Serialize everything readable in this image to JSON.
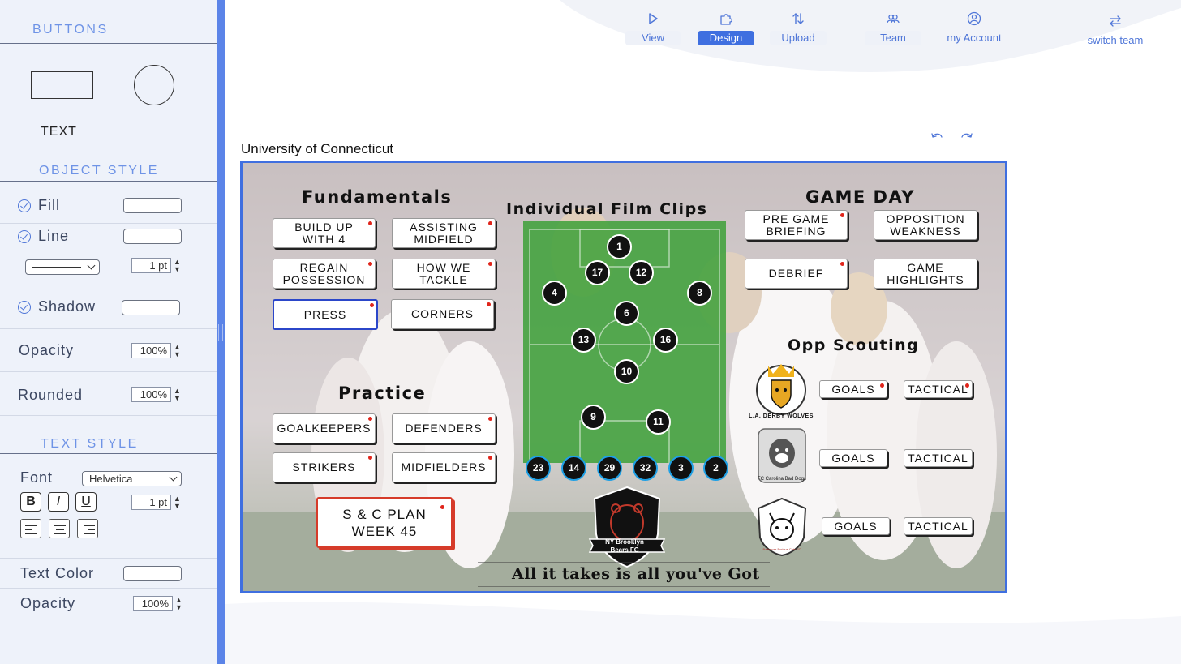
{
  "sidebar": {
    "buttons_title": "BUTTONS",
    "text_tool": "TEXT",
    "object_style_title": "OBJECT STYLE",
    "fill_label": "Fill",
    "line_label": "Line",
    "line_width": "1 pt",
    "shadow_label": "Shadow",
    "opacity_label": "Opacity",
    "opacity_value": "100%",
    "rounded_label": "Rounded",
    "rounded_value": "100%",
    "text_style_title": "TEXT STYLE",
    "font_label": "Font",
    "font_value": "Helvetica",
    "bold": "B",
    "italic": "I",
    "underline": "U",
    "text_size": "1 pt",
    "text_color_label": "Text Color",
    "text_opacity_label": "Opacity",
    "text_opacity_value": "100%"
  },
  "nav": {
    "view": "View",
    "design": "Design",
    "upload": "Upload",
    "team": "Team",
    "account": "my Account",
    "switch_team": "switch team"
  },
  "board_title": "University of Connecticut",
  "board": {
    "fundamentals": {
      "title": "Fundamentals",
      "build_up": "BUILD UP\nWITH 4",
      "assisting": "ASSISTING\nMIDFIELD",
      "regain": "REGAIN\nPOSSESSION",
      "tackle": "HOW WE TACKLE",
      "press": "PRESS",
      "corners": "CORNERS"
    },
    "practice": {
      "title": "Practice",
      "goalkeepers": "GOALKEEPERS",
      "defenders": "DEFENDERS",
      "strikers": "STRIKERS",
      "midfielders": "MIDFIELDERS"
    },
    "sc_plan": "S & C PLAN\nWEEK 45",
    "film_title": "Individual Film Clips",
    "players": [
      "1",
      "17",
      "12",
      "4",
      "8",
      "6",
      "13",
      "16",
      "10",
      "9",
      "11"
    ],
    "subs": [
      "23",
      "14",
      "29",
      "32",
      "3",
      "2"
    ],
    "crest_text": "NY Brooklyn\nBears FC",
    "slogan": "All it takes is all you've Got",
    "game_day": {
      "title": "GAME DAY",
      "pre_game": "PRE GAME\nBRIEFING",
      "opposition": "OPPOSITION\nWEAKNESS",
      "debrief": "DEBRIEF",
      "highlights": "GAME\nHIGHLIGHTS"
    },
    "opp_scouting": {
      "title": "Opp Scouting",
      "teams": [
        {
          "logo_text": "L.A. DERBY WOLVES",
          "goals": "GOALS",
          "tactical": "TACTICAL"
        },
        {
          "logo_text": "FC Carolina Bad Dogs",
          "goals": "GOALS",
          "tactical": "TACTICAL"
        },
        {
          "logo_text": "Baltimore Furious Cats FC",
          "goals": "GOALS",
          "tactical": "TACTICAL"
        }
      ]
    }
  },
  "colors": {
    "accent": "#3f6fe0",
    "sidebar_bg": "#eef2fa",
    "pitch": "#3ca037",
    "notification": "#e0251b"
  }
}
